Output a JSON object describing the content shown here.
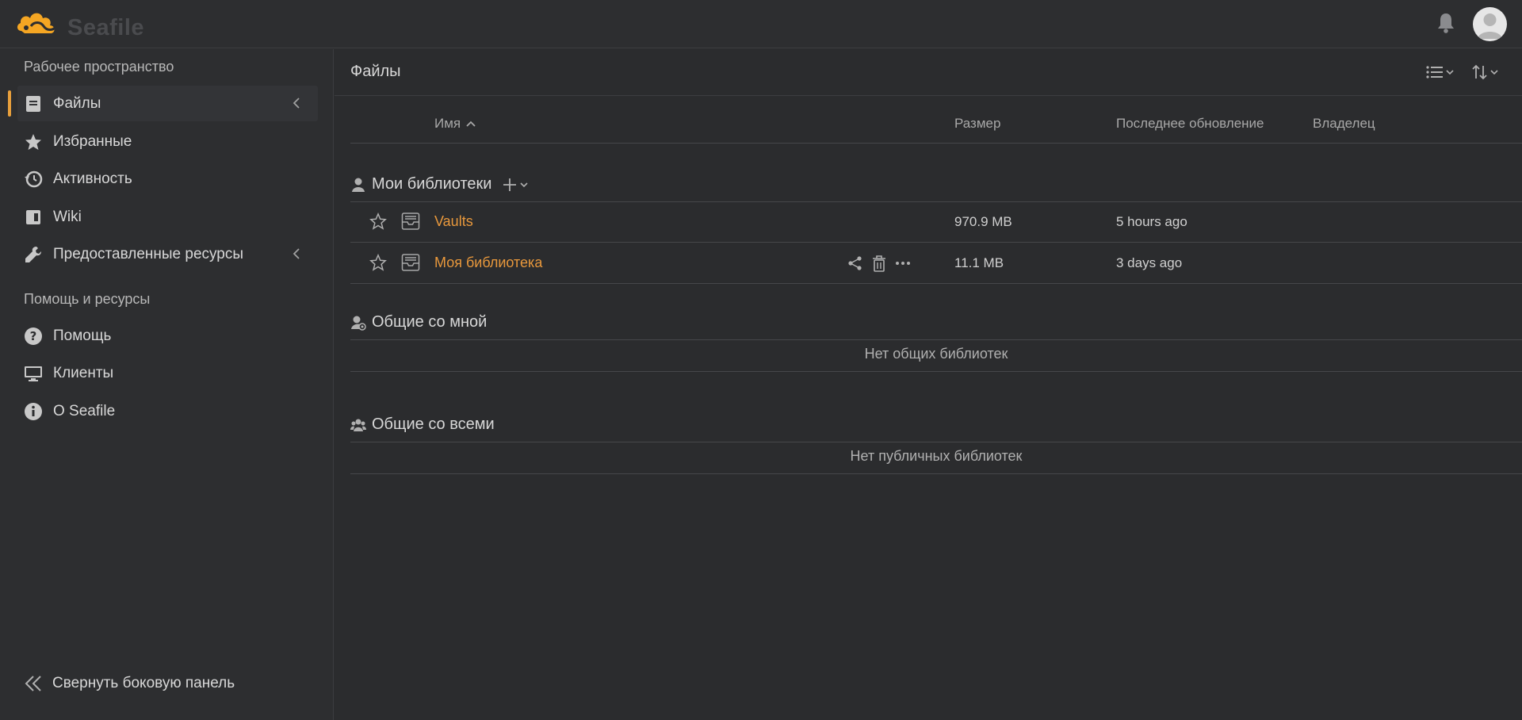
{
  "app": {
    "logo_text": "Seafile"
  },
  "sidebar": {
    "workspace_heading": "Рабочее пространство",
    "items": [
      {
        "label": "Файлы",
        "icon": "files-icon"
      },
      {
        "label": "Избранные",
        "icon": "star-icon"
      },
      {
        "label": "Активность",
        "icon": "history-icon"
      },
      {
        "label": "Wiki",
        "icon": "wiki-icon"
      },
      {
        "label": "Предоставленные ресурсы",
        "icon": "wrench-icon"
      }
    ],
    "help_heading": "Помощь и ресурсы",
    "help_items": [
      {
        "label": "Помощь",
        "icon": "question-icon"
      },
      {
        "label": "Клиенты",
        "icon": "monitor-icon"
      },
      {
        "label": "O Seafile",
        "icon": "info-icon"
      }
    ],
    "collapse_label": "Свернуть боковую панель"
  },
  "main": {
    "title": "Файлы",
    "columns": {
      "name": "Имя",
      "size": "Размер",
      "updated": "Последнее обновление",
      "owner": "Владелец"
    },
    "my_libraries": {
      "title": "Мои библиотеки",
      "rows": [
        {
          "name": "Vaults",
          "size": "970.9 MB",
          "updated": "5 hours ago"
        },
        {
          "name": "Моя библиотека",
          "size": "11.1 MB",
          "updated": "3 days ago"
        }
      ]
    },
    "shared_with_me": {
      "title": "Общие со мной",
      "empty": "Нет общих библиотек"
    },
    "shared_with_all": {
      "title": "Общие со всеми",
      "empty": "Нет публичных библиотек"
    }
  },
  "colors": {
    "accent": "#e8a03c",
    "link": "#e8983c",
    "background": "#2b2c2e"
  }
}
